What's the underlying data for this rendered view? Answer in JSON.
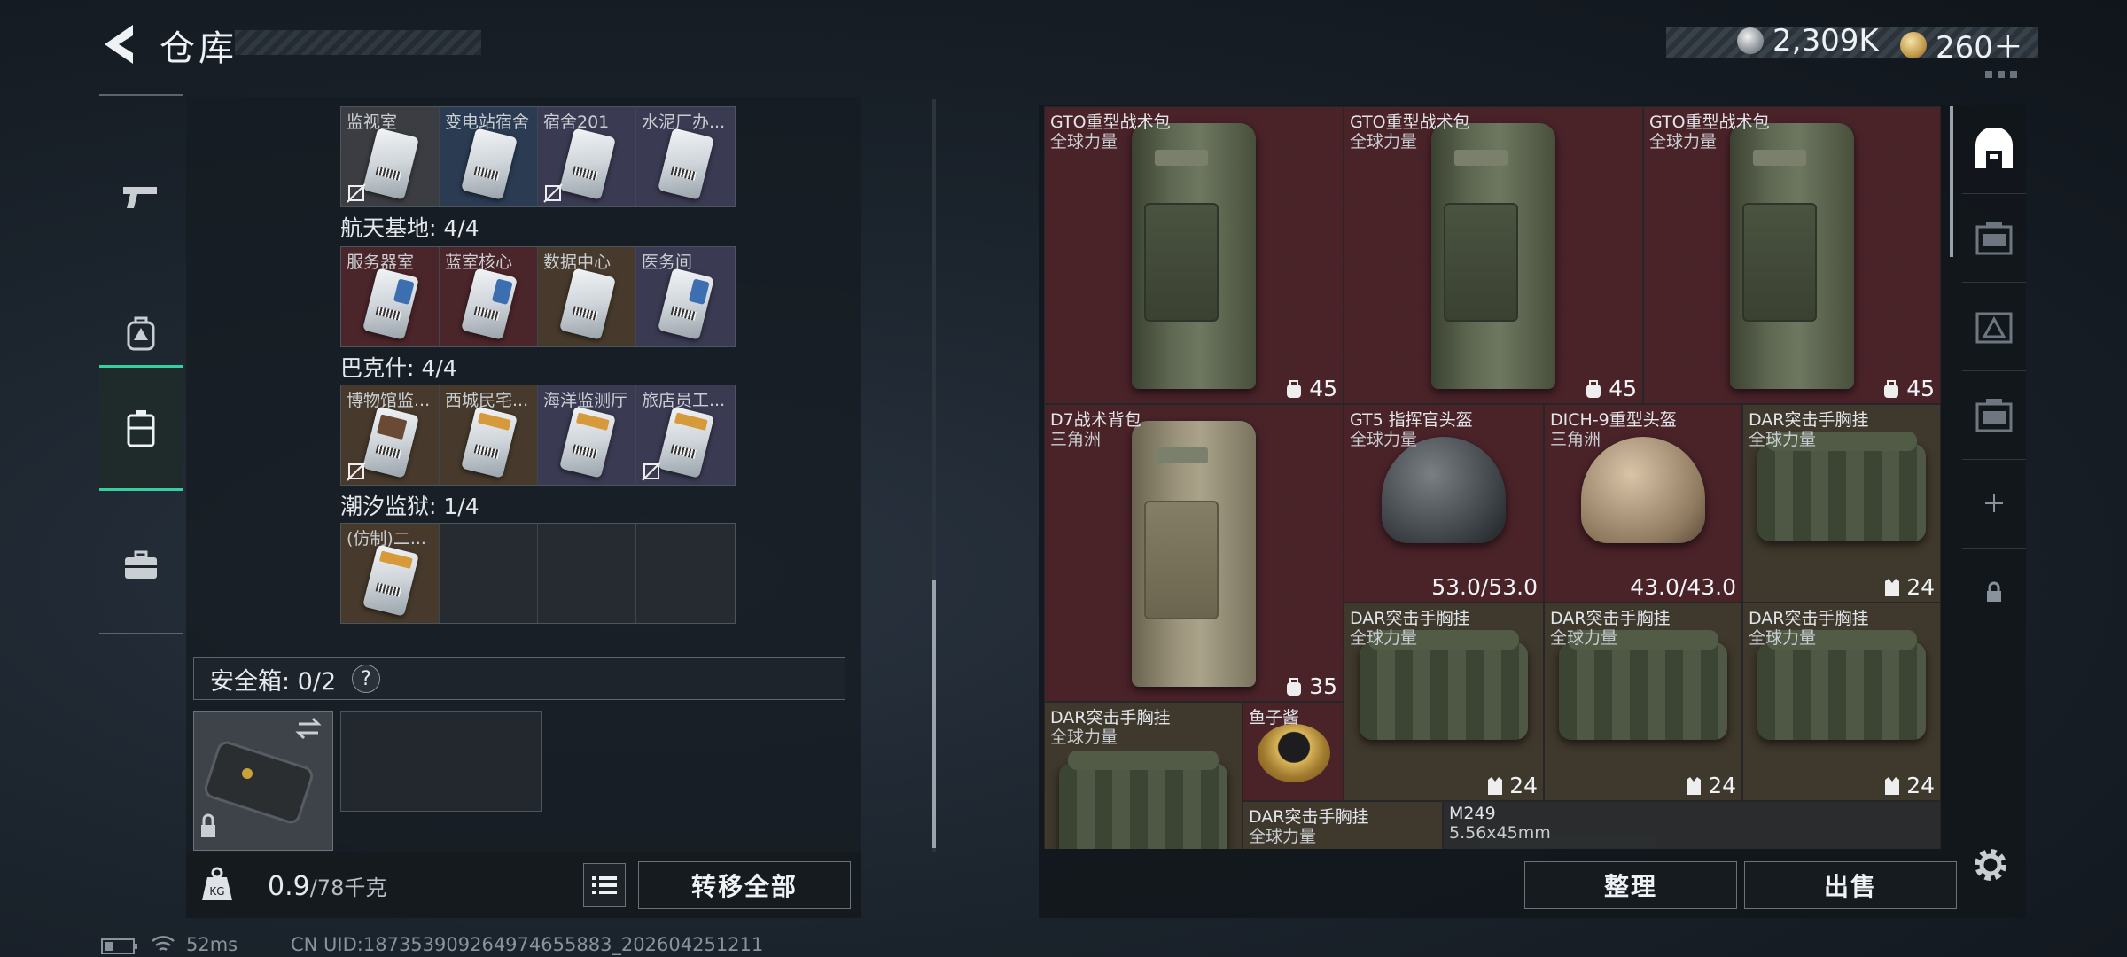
{
  "header": {
    "title": "仓库"
  },
  "currency": {
    "silver": "2,309K",
    "gold": "260＋"
  },
  "nav": [
    {
      "name": "weapons",
      "icon": "pistol-icon"
    },
    {
      "name": "equipment",
      "icon": "backpack-icon"
    },
    {
      "name": "storage",
      "icon": "case-icon",
      "active": true
    },
    {
      "name": "tools",
      "icon": "toolbox-icon"
    }
  ],
  "keycards": {
    "group0": {
      "cells": [
        "监视室",
        "变电站宿舍",
        "宿舍201",
        "水泥厂办..."
      ]
    },
    "group1": {
      "title": "航天基地: 4/4",
      "cells": [
        "服务器室",
        "蓝室核心",
        "数据中心",
        "医务间"
      ]
    },
    "group2": {
      "title": "巴克什: 4/4",
      "cells": [
        "博物馆监...",
        "西城民宅...",
        "海洋监测厅",
        "旅店员工..."
      ]
    },
    "group3": {
      "title": "潮汐监狱: 1/4",
      "cells": [
        "(仿制)二..."
      ]
    }
  },
  "safe": {
    "label": "安全箱: 0/2",
    "help": "?"
  },
  "footer": {
    "weight_value": "0.9",
    "weight_total": "/78千克",
    "transfer_all": "转移全部"
  },
  "stash": {
    "items": [
      {
        "name": "GTO重型战术包",
        "sub": "全球力量",
        "value": "45"
      },
      {
        "name": "GTO重型战术包",
        "sub": "全球力量",
        "value": "45"
      },
      {
        "name": "GTO重型战术包",
        "sub": "全球力量",
        "value": "45"
      },
      {
        "name": "D7战术背包",
        "sub": "三角洲",
        "value": "35"
      },
      {
        "name": "GT5 指挥官头盔",
        "sub": "全球力量",
        "value": "53.0/53.0"
      },
      {
        "name": "DICH-9重型头盔",
        "sub": "三角洲",
        "value": "43.0/43.0"
      },
      {
        "name": "DAR突击手胸挂",
        "sub": "全球力量",
        "value": "24"
      },
      {
        "name": "DAR突击手胸挂",
        "sub": "全球力量",
        "value": "24"
      },
      {
        "name": "DAR突击手胸挂",
        "sub": "全球力量",
        "value": "24"
      },
      {
        "name": "DAR突击手胸挂",
        "sub": "全球力量",
        "value": "24"
      },
      {
        "name": "DAR突击手胸挂",
        "sub": "全球力量",
        "value": ""
      },
      {
        "name": "鱼子酱",
        "sub": "",
        "value": ""
      },
      {
        "name": "DAR突击手胸挂",
        "sub": "全球力量",
        "value": ""
      },
      {
        "name": "M249",
        "sub": "5.56x45mm",
        "value": ""
      }
    ],
    "sort_button": "整理",
    "sell_button": "出售"
  },
  "status": {
    "ping": "52ms",
    "uid": "CN UID:187353909264974655883_202604251211"
  },
  "colors": {
    "accent": "#35d0a0",
    "item_red": "#4a2329",
    "item_brown": "#3f382c"
  }
}
